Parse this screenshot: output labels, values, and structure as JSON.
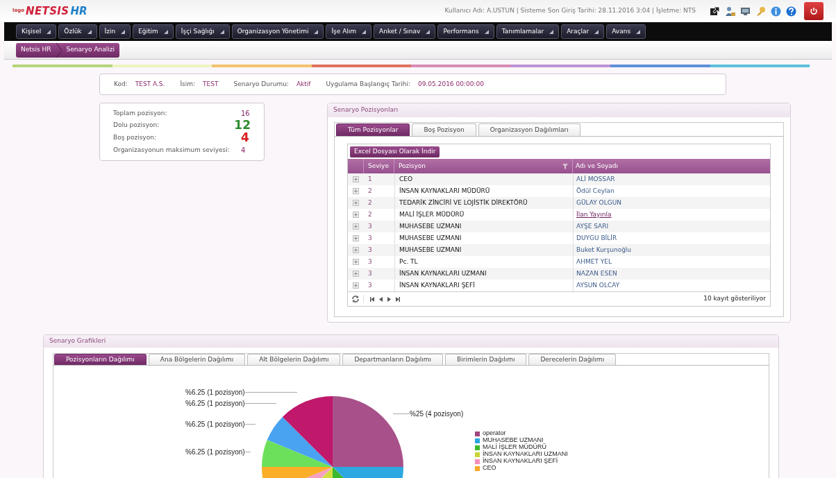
{
  "header": {
    "logo_small": "logo",
    "logo_main": "NETSIS",
    "logo_suffix": "HR",
    "user_info": "Kullanıcı Adı: A.USTUN | Sisteme Son Giriş Tarihi: 28.11.2016 3:04 | İşletme: NTS"
  },
  "menu": [
    "Kişisel",
    "Özlük",
    "İzin",
    "Eğitim",
    "İşçi Sağlığı",
    "Organizasyon Yönetimi",
    "İşe Alım",
    "Anket / Sınav",
    "Performans",
    "Tanımlamalar",
    "Araçlar",
    "Avans"
  ],
  "breadcrumb": [
    "Netsis HR",
    "Senaryo Analizi"
  ],
  "info": [
    {
      "label": "Kod:",
      "value": "TEST A.S."
    },
    {
      "label": "İsim:",
      "value": "TEST"
    },
    {
      "label": "Senaryo Durumu:",
      "value": "Aktif"
    },
    {
      "label": "Uygulama Başlangıç Tarihi:",
      "value": "09.05.2016 00:00:00"
    }
  ],
  "stats": [
    {
      "label": "Toplam pozisyon:",
      "value": "16",
      "kind": "small"
    },
    {
      "label": "Dolu pozisyon:",
      "value": "12",
      "kind": "good"
    },
    {
      "label": "Boş pozisyon:",
      "value": "4",
      "kind": "bad"
    },
    {
      "label": "Organizasyonun maksimum seviyesi:",
      "value": "4",
      "kind": "small"
    }
  ],
  "positions_panel": {
    "title": "Senaryo Pozisyonları",
    "tabs": [
      {
        "label": "Tüm Pozisyonlar",
        "selected": true
      },
      {
        "label": "Boş Pozisyon",
        "selected": false
      },
      {
        "label": "Organizasyon Dağılımları",
        "selected": false
      }
    ],
    "export_button": "Excel Dosyası Olarak İndir",
    "columns": [
      "Seviye",
      "Pozisyon",
      "Adı ve Soyadı"
    ],
    "rows": [
      {
        "level": "1",
        "position": "CEO",
        "name": "ALİ MOSSAR",
        "link": false
      },
      {
        "level": "2",
        "position": "İNSAN KAYNAKLARI MÜDÜRÜ",
        "name": "Ödül Ceylan",
        "link": false
      },
      {
        "level": "2",
        "position": "TEDARİK ZİNCİRİ VE LOJİSTİK DİREKTÖRÜ",
        "name": "GÜLAY OLGUN",
        "link": false
      },
      {
        "level": "2",
        "position": "MALİ İŞLER MÜDÜRÜ",
        "name": "İlan Yayınla",
        "link": true
      },
      {
        "level": "3",
        "position": "MUHASEBE UZMANI",
        "name": "AYŞE SARI",
        "link": false
      },
      {
        "level": "3",
        "position": "MUHASEBE UZMANI",
        "name": "DUYGU BİLİR",
        "link": false
      },
      {
        "level": "3",
        "position": "MUHASEBE UZMANI",
        "name": "Buket Kurşunoğlu",
        "link": false
      },
      {
        "level": "3",
        "position": "Pc. TL",
        "name": "AHMET YEL",
        "link": false
      },
      {
        "level": "3",
        "position": "İNSAN KAYNAKLARI UZMANI",
        "name": "NAZAN ESEN",
        "link": false
      },
      {
        "level": "3",
        "position": "İNSAN KAYNAKLARI ŞEFİ",
        "name": "AYSUN OLCAY",
        "link": false
      }
    ],
    "footer": "10 kayıt gösteriliyor"
  },
  "charts_panel": {
    "title": "Senaryo Grafikleri",
    "tabs": [
      {
        "label": "Pozisyonların Dağılımı",
        "selected": true
      },
      {
        "label": "Ana Bölgelerin Dağılımı",
        "selected": false
      },
      {
        "label": "Alt Bölgelerin Dağılımı",
        "selected": false
      },
      {
        "label": "Departmanların Dağılımı",
        "selected": false
      },
      {
        "label": "Birimlerin Dağılımı",
        "selected": false
      },
      {
        "label": "Derecelerin Dağılımı",
        "selected": false
      }
    ],
    "slice_labels": [
      "%6.25 (1 pozisyon)",
      "%6.25 (1 pozisyon)",
      "%6.25 (1 pozisyon)",
      "%6.25 (1 pozisyon)",
      "%25 (4 pozisyon)"
    ],
    "legend": [
      {
        "label": "operator",
        "color": "#a0457f"
      },
      {
        "label": "MUHASEBE UZMANI",
        "color": "#29a5dc"
      },
      {
        "label": "MALİ İŞLER MÜDÜRÜ",
        "color": "#3db82e"
      },
      {
        "label": "İNSAN KAYNAKLARI UZMANI",
        "color": "#c8d63a"
      },
      {
        "label": "İNSAN KAYNAKLARI ŞEFİ",
        "color": "#f48fb8"
      },
      {
        "label": "CEO",
        "color": "#f9a825"
      }
    ]
  }
}
